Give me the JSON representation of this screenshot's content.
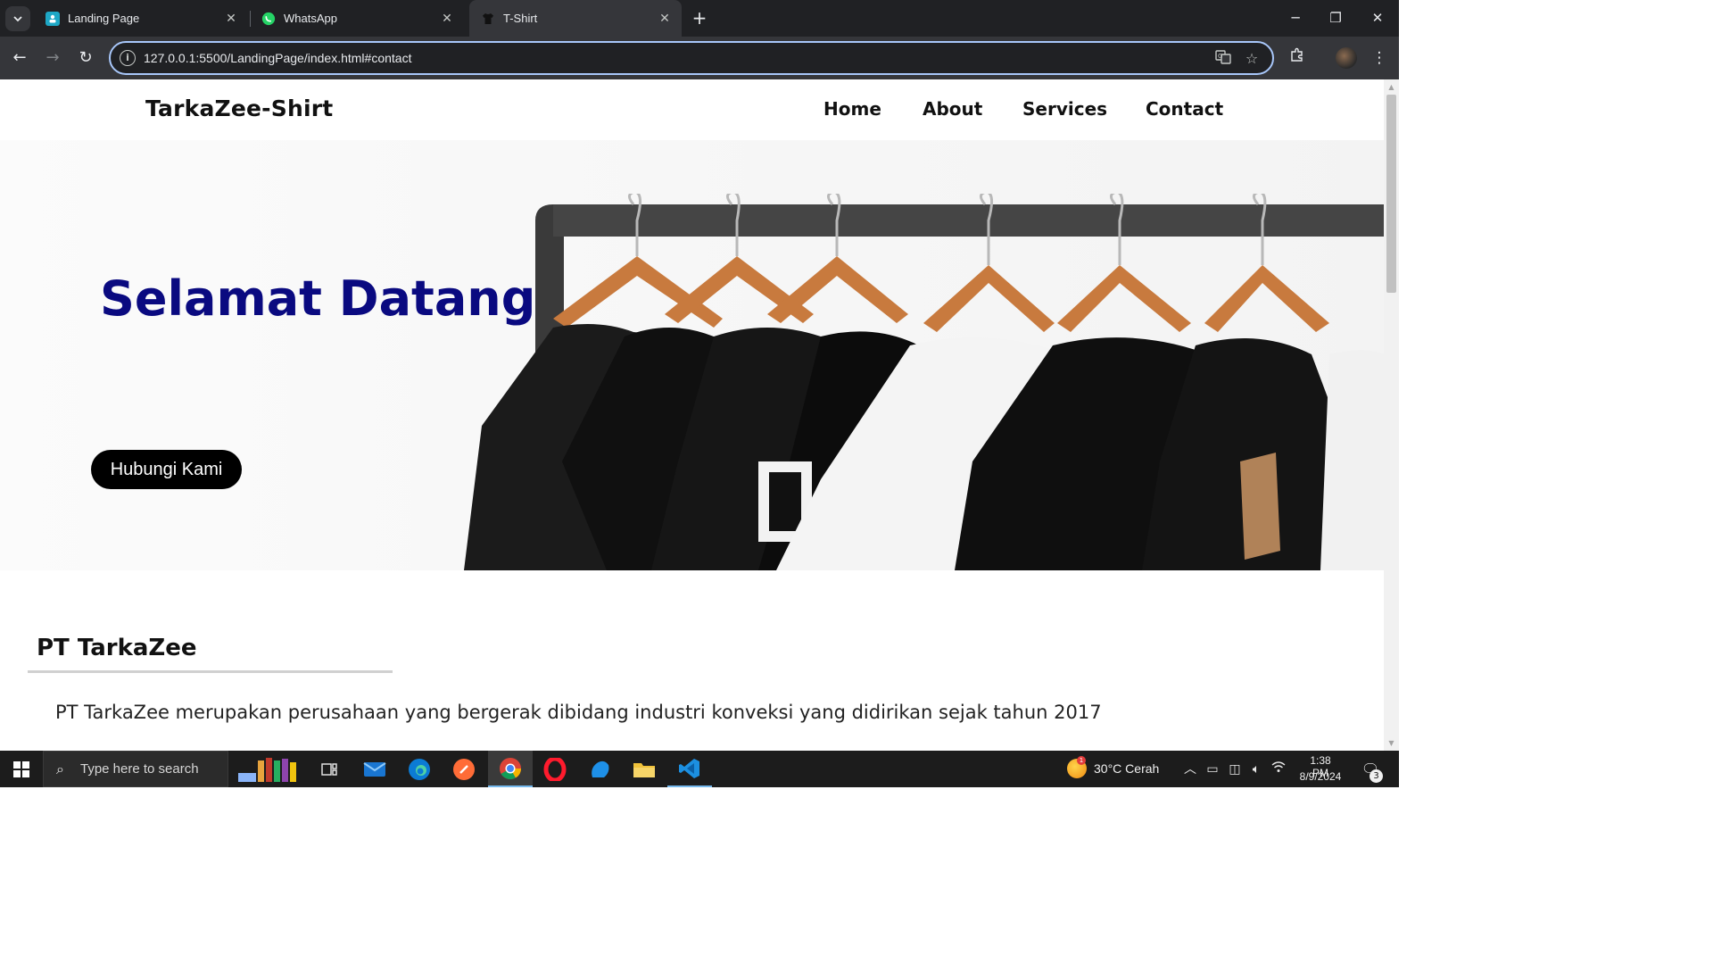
{
  "browser": {
    "tabs": [
      {
        "title": "Landing Page",
        "active": false
      },
      {
        "title": "WhatsApp",
        "active": false
      },
      {
        "title": "T-Shirt",
        "active": true
      }
    ],
    "url": "127.0.0.1:5500/LandingPage/index.html#contact",
    "accent_color": "#a8c7fa"
  },
  "site": {
    "brand": "TarkaZee-Shirt",
    "nav": [
      "Home",
      "About",
      "Services",
      "Contact"
    ],
    "hero": {
      "title": "Selamat Datang",
      "button": "Hubungi Kami",
      "title_color": "#0a0a80"
    },
    "about": {
      "title": "PT TarkaZee",
      "paragraph": "PT TarkaZee merupakan perusahaan yang bergerak dibidang industri konveksi yang didirikan sejak tahun 2017"
    }
  },
  "taskbar": {
    "search_placeholder": "Type here to search",
    "weather": "30°C  Cerah",
    "weather_badge": "1",
    "time": "1:38 PM",
    "date": "8/9/2024",
    "notification_count": "3"
  }
}
